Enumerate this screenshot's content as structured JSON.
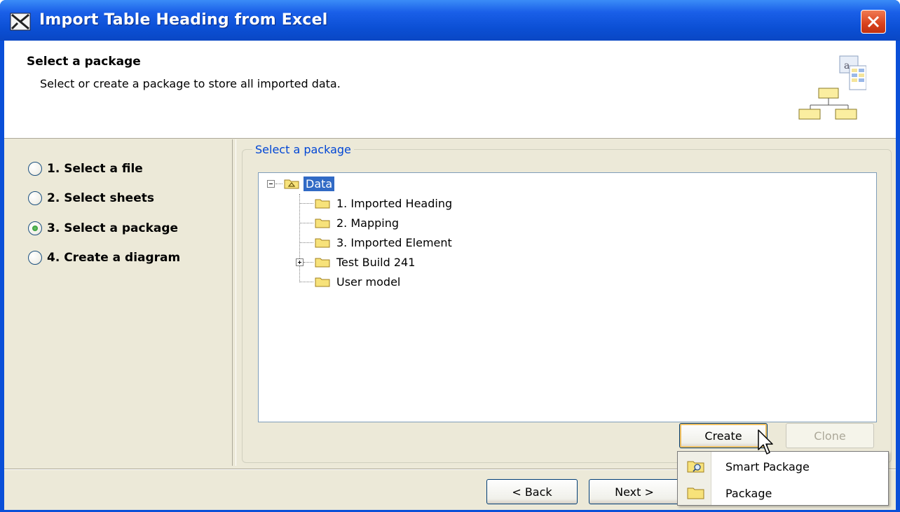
{
  "window": {
    "title": "Import Table Heading from Excel"
  },
  "header": {
    "title": "Select a package",
    "description": "Select or create a package to store all imported data."
  },
  "steps": [
    {
      "label": "1. Select a file",
      "checked": false
    },
    {
      "label": "2. Select sheets",
      "checked": false
    },
    {
      "label": "3. Select a package",
      "checked": true
    },
    {
      "label": "4. Create a diagram",
      "checked": false
    }
  ],
  "group": {
    "legend": "Select a package"
  },
  "tree": {
    "root": {
      "label": "Data",
      "selected": true,
      "expanded": true
    },
    "children": [
      {
        "label": "1. Imported Heading",
        "expandable": false
      },
      {
        "label": "2. Mapping",
        "expandable": false
      },
      {
        "label": "3. Imported Element",
        "expandable": false
      },
      {
        "label": "Test Build 241",
        "expandable": true
      },
      {
        "label": "User model",
        "expandable": false
      }
    ]
  },
  "buttons": {
    "create": "Create",
    "clone": "Clone",
    "back": "< Back",
    "next": "Next >"
  },
  "menu": {
    "items": [
      {
        "label": "Smart Package",
        "icon": "smart-package-icon"
      },
      {
        "label": "Package",
        "icon": "package-icon"
      }
    ]
  },
  "colors": {
    "titlebar": "#0b4fd4",
    "selection": "#316ac5",
    "legend": "#0046d5",
    "dialog_bg": "#ece9d8"
  }
}
